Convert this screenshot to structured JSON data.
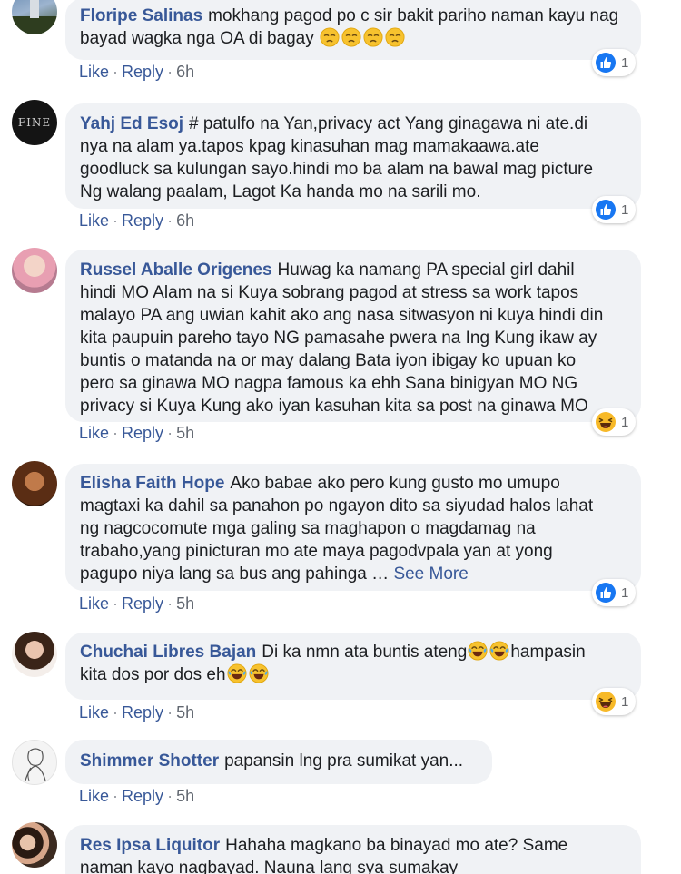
{
  "comments": [
    {
      "name": "Floripe Salinas",
      "text": "mokhang pagod po c sir bakit pariho naman kayu nag bayad wagka nga OA di bagay",
      "emojis": [
        "pensive",
        "pensive",
        "pensive",
        "pensive"
      ],
      "like": "Like",
      "reply": "Reply",
      "time": "6h",
      "reaction": "like",
      "reaction_count": "1"
    },
    {
      "name": "Yahj Ed Esoj",
      "avatar_text": "FINE",
      "line1": "# patulfo na Yan,privacy act Yang ginagawa ni ate.di",
      "line2": "nya na alam ya.tapos kpag kinasuhan mag mamakaawa.ate",
      "line3": "goodluck sa kulungan sayo.hindi mo ba alam na bawal mag picture",
      "line4": "Ng walang paalam, Lagot Ka handa mo na sarili mo.",
      "like": "Like",
      "reply": "Reply",
      "time": "6h",
      "reaction": "like",
      "reaction_count": "1"
    },
    {
      "name": "Russel Aballe Origenes",
      "line1": "Huwag ka namang PA special girl dahil",
      "line2": "hindi MO Alam na si Kuya sobrang pagod at stress sa work tapos",
      "line3": "malayo PA ang uwian kahit ako ang nasa sitwasyon ni kuya hindi din",
      "line4": "kita paupuin pareho tayo NG pamasahe pwera na Ing Kung ikaw ay",
      "line5": "buntis o matanda na or may dalang Bata iyon ibigay ko upuan ko",
      "line6": "pero sa ginawa MO nagpa famous ka ehh Sana binigyan MO NG",
      "line7": "privacy si Kuya Kung ako iyan kasuhan kita sa post na ginawa MO",
      "like": "Like",
      "reply": "Reply",
      "time": "5h",
      "reaction": "haha",
      "reaction_count": "1"
    },
    {
      "name": "Elisha Faith Hope",
      "line1": "Ako babae ako pero kung gusto mo umupo",
      "line2": "magtaxi ka dahil sa panahon po ngayon dito sa siyudad halos lahat",
      "line3": "ng nagcocomute mga galing sa maghapon o magdamag na",
      "line4": "trabaho,yang pinicturan mo ate maya pagodvpala yan at yong",
      "line5": "pagupo niya lang sa bus ang pahinga …",
      "see_more": "See More",
      "like": "Like",
      "reply": "Reply",
      "time": "5h",
      "reaction": "like",
      "reaction_count": "1"
    },
    {
      "name": "Chuchai Libres Bajan",
      "text_a": "Di ka nmn ata buntis ateng",
      "text_b": "hampasin",
      "text_c": "kita dos por dos eh",
      "like": "Like",
      "reply": "Reply",
      "time": "5h",
      "reaction": "haha",
      "reaction_count": "1"
    },
    {
      "name": "Shimmer Shotter",
      "text": "papansin lng pra sumikat yan...",
      "like": "Like",
      "reply": "Reply",
      "time": "5h"
    },
    {
      "name": "Res Ipsa Liquitor",
      "line1": "Hahaha magkano ba binayad mo ate? Same",
      "line2": "naman kayo nagbayad. Nauna lang sya sumakay"
    }
  ],
  "colors": {
    "name": "#385898",
    "bubble": "#f0f2f5",
    "like_blue": "#1877f2",
    "haha_yellow": "#f7b928"
  }
}
